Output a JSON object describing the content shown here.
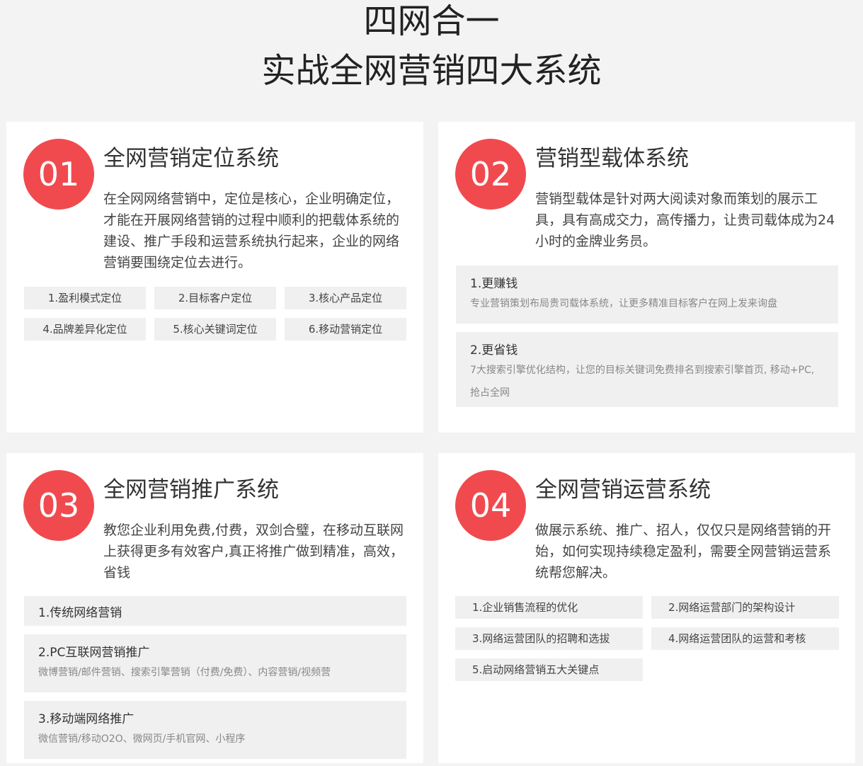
{
  "header": {
    "line1": "四网合一",
    "line2": "实战全网营销四大系统"
  },
  "cards": [
    {
      "number": "01",
      "title": "全网营销定位系统",
      "description": "在全网网络营销中，定位是核心，企业明确定位，才能在开展网络营销的过程中顺利的把载体系统的建设、推广手段和运营系统执行起来，企业的网络营销要围绕定位去进行。",
      "chips": [
        "1.盈利模式定位",
        "2.目标客户定位",
        "3.核心产品定位",
        "4.品牌差异化定位",
        "5.核心关键词定位",
        "6.移动营销定位"
      ]
    },
    {
      "number": "02",
      "title": "营销型载体系统",
      "description": "营销型载体是针对两大阅读对象而策划的展示工具，具有高成交力，高传播力，让贵司载体成为24小时的金牌业务员。",
      "boxes": [
        {
          "title": "1.更赚钱",
          "desc": "专业营销策划布局贵司载体系统，让更多精准目标客户在网上发来询盘"
        },
        {
          "title": "2.更省钱",
          "desc": "7大搜索引擎优化结构，让您的目标关键词免费排名到搜索引擎首页, 移动+PC,抢占全网"
        }
      ]
    },
    {
      "number": "03",
      "title": "全网营销推广系统",
      "description": "教您企业利用免费,付费，双剑合璧，在移动互联网上获得更多有效客户,真正将推广做到精准，高效，省钱",
      "boxes": [
        {
          "title": "1.传统网络营销",
          "desc": ""
        },
        {
          "title": "2.PC互联网营销推广",
          "desc": "微博营销/邮件营销、搜索引擎营销（付费/免费）、内容营销/视频营"
        },
        {
          "title": "3.移动端网络推广",
          "desc": "微信营销/移动O2O、微网页/手机官网、小程序"
        }
      ]
    },
    {
      "number": "04",
      "title": "全网营销运营系统",
      "description": "做展示系统、推广、招人，仅仅只是网络营销的开始，如何实现持续稳定盈利，需要全网营销运营系统帮您解决。",
      "chips": [
        "1.企业销售流程的优化",
        "2.网络运营部门的架构设计",
        "3.网络运营团队的招聘和选拔",
        "4.网络运营团队的运营和考核",
        "5.启动网络营销五大关键点"
      ]
    }
  ],
  "colors": {
    "accent": "#f04a4f",
    "background": "#f3f3f3",
    "card": "#ffffff",
    "chip": "#f0f0f0"
  }
}
